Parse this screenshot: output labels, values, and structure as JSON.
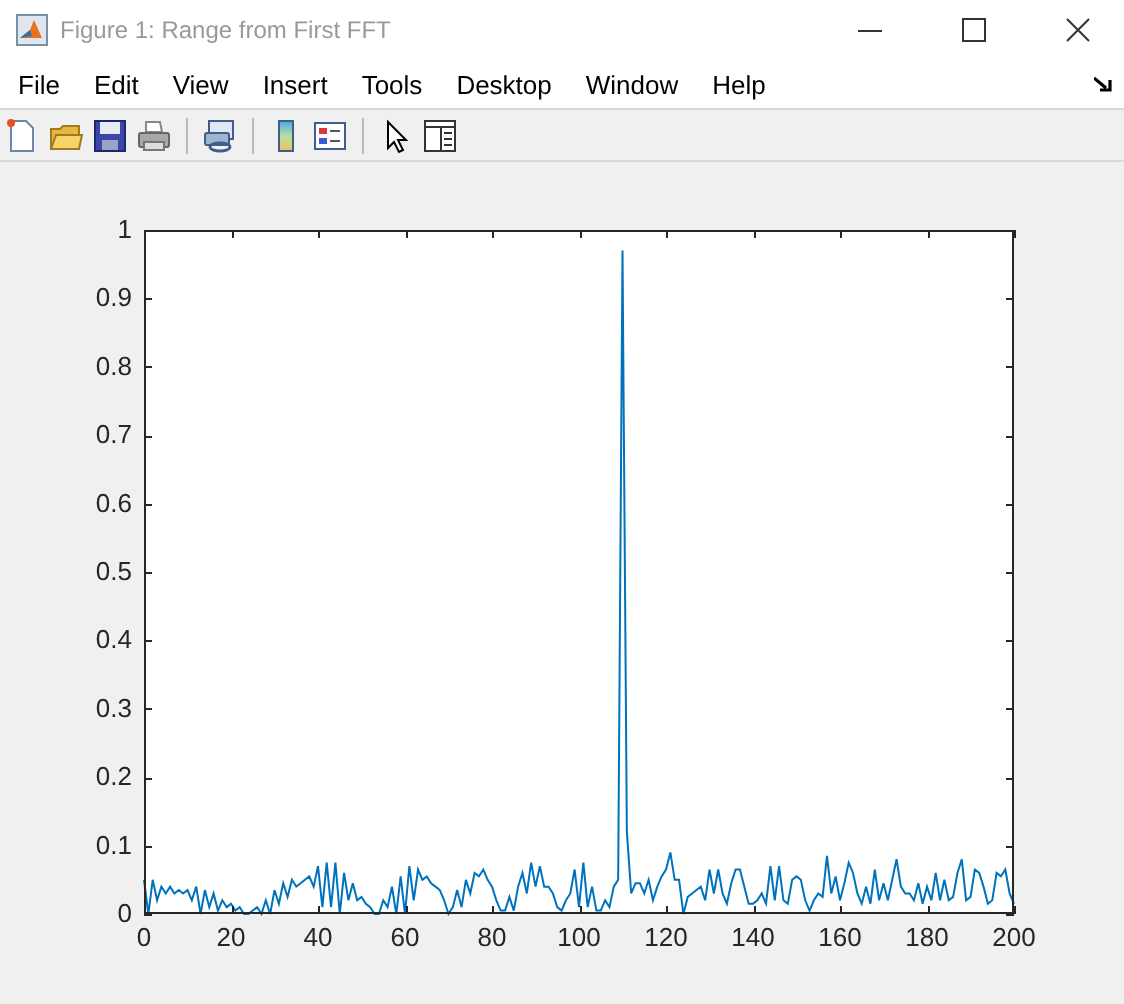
{
  "window": {
    "title": "Figure 1: Range from First FFT"
  },
  "menu": [
    "File",
    "Edit",
    "View",
    "Insert",
    "Tools",
    "Desktop",
    "Window",
    "Help"
  ],
  "figure": {
    "chart_data": {
      "type": "line",
      "xlim": [
        0,
        200
      ],
      "ylim": [
        0,
        1
      ],
      "xticks": [
        0,
        20,
        40,
        60,
        80,
        100,
        120,
        140,
        160,
        180,
        200
      ],
      "yticks": [
        0,
        0.1,
        0.2,
        0.3,
        0.4,
        0.5,
        0.6,
        0.7,
        0.8,
        0.9,
        1
      ],
      "x": [
        0,
        1,
        2,
        3,
        4,
        5,
        6,
        7,
        8,
        9,
        10,
        11,
        12,
        13,
        14,
        15,
        16,
        17,
        18,
        19,
        20,
        21,
        22,
        23,
        24,
        25,
        26,
        27,
        28,
        29,
        30,
        31,
        32,
        33,
        34,
        35,
        36,
        37,
        38,
        39,
        40,
        41,
        42,
        43,
        44,
        45,
        46,
        47,
        48,
        49,
        50,
        51,
        52,
        53,
        54,
        55,
        56,
        57,
        58,
        59,
        60,
        61,
        62,
        63,
        64,
        65,
        66,
        67,
        68,
        69,
        70,
        71,
        72,
        73,
        74,
        75,
        76,
        77,
        78,
        79,
        80,
        81,
        82,
        83,
        84,
        85,
        86,
        87,
        88,
        89,
        90,
        91,
        92,
        93,
        94,
        95,
        96,
        97,
        98,
        99,
        100,
        101,
        102,
        103,
        104,
        105,
        106,
        107,
        108,
        109,
        110,
        111,
        112,
        113,
        114,
        115,
        116,
        117,
        118,
        119,
        120,
        121,
        122,
        123,
        124,
        125,
        126,
        127,
        128,
        129,
        130,
        131,
        132,
        133,
        134,
        135,
        136,
        137,
        138,
        139,
        140,
        141,
        142,
        143,
        144,
        145,
        146,
        147,
        148,
        149,
        150,
        151,
        152,
        153,
        154,
        155,
        156,
        157,
        158,
        159,
        160,
        161,
        162,
        163,
        164,
        165,
        166,
        167,
        168,
        169,
        170,
        171,
        172,
        173,
        174,
        175,
        176,
        177,
        178,
        179,
        180,
        181,
        182,
        183,
        184,
        185,
        186,
        187,
        188,
        189,
        190,
        191,
        192,
        193,
        194,
        195,
        196,
        197,
        198,
        199,
        200
      ],
      "series": [
        {
          "color": "#0072bd",
          "values": [
            0.05,
            0.0,
            0.05,
            0.02,
            0.04,
            0.03,
            0.04,
            0.03,
            0.035,
            0.03,
            0.035,
            0.02,
            0.04,
            0.0,
            0.035,
            0.01,
            0.03,
            0.005,
            0.02,
            0.01,
            0.015,
            0.005,
            0.01,
            0.0,
            0.0,
            0.005,
            0.01,
            0.0,
            0.02,
            0.0,
            0.035,
            0.015,
            0.045,
            0.025,
            0.05,
            0.04,
            0.045,
            0.05,
            0.055,
            0.04,
            0.07,
            0.01,
            0.075,
            0.01,
            0.075,
            0.0,
            0.06,
            0.02,
            0.045,
            0.02,
            0.025,
            0.015,
            0.01,
            0.0,
            0.0,
            0.02,
            0.01,
            0.04,
            0.0,
            0.055,
            0.0,
            0.07,
            0.02,
            0.065,
            0.05,
            0.055,
            0.045,
            0.04,
            0.035,
            0.02,
            0.0,
            0.01,
            0.035,
            0.01,
            0.05,
            0.03,
            0.06,
            0.055,
            0.065,
            0.05,
            0.04,
            0.02,
            0.005,
            0.005,
            0.025,
            0.005,
            0.04,
            0.06,
            0.03,
            0.075,
            0.04,
            0.07,
            0.04,
            0.04,
            0.03,
            0.01,
            0.005,
            0.02,
            0.03,
            0.065,
            0.01,
            0.075,
            0.01,
            0.04,
            0.005,
            0.005,
            0.02,
            0.01,
            0.04,
            0.05,
            0.97,
            0.12,
            0.03,
            0.045,
            0.045,
            0.03,
            0.05,
            0.02,
            0.04,
            0.055,
            0.065,
            0.09,
            0.05,
            0.05,
            0.0,
            0.025,
            0.03,
            0.035,
            0.04,
            0.02,
            0.065,
            0.03,
            0.065,
            0.03,
            0.015,
            0.045,
            0.065,
            0.065,
            0.04,
            0.015,
            0.015,
            0.02,
            0.03,
            0.015,
            0.07,
            0.02,
            0.07,
            0.02,
            0.015,
            0.05,
            0.055,
            0.05,
            0.02,
            0.005,
            0.02,
            0.03,
            0.025,
            0.085,
            0.03,
            0.055,
            0.02,
            0.045,
            0.075,
            0.06,
            0.03,
            0.015,
            0.04,
            0.015,
            0.065,
            0.02,
            0.045,
            0.02,
            0.05,
            0.08,
            0.04,
            0.03,
            0.03,
            0.02,
            0.045,
            0.015,
            0.04,
            0.02,
            0.06,
            0.02,
            0.05,
            0.02,
            0.025,
            0.06,
            0.08,
            0.02,
            0.025,
            0.065,
            0.06,
            0.04,
            0.015,
            0.02,
            0.06,
            0.055,
            0.065,
            0.03,
            0.015
          ]
        }
      ]
    }
  }
}
